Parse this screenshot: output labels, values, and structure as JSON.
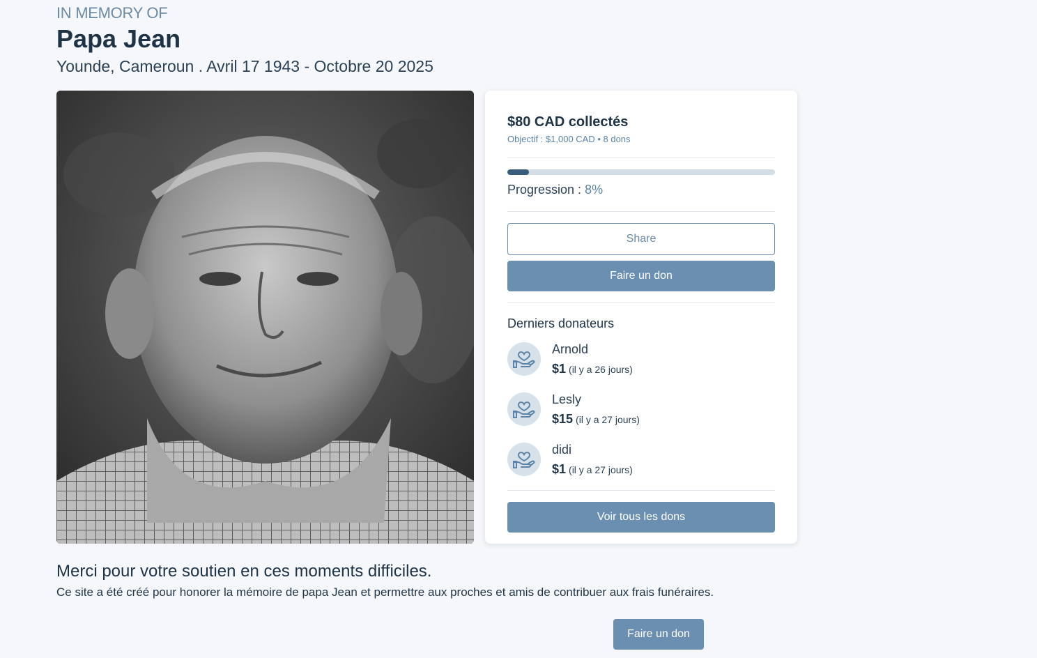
{
  "header": {
    "memory_label": "IN MEMORY OF",
    "name": "Papa Jean",
    "subtitle": "Younde, Cameroun . Avril 17 1943 - Octobre 20 2025"
  },
  "photo": {
    "description_icon": "portrait-photo"
  },
  "fundraiser": {
    "raised": "$80 CAD collectés",
    "goal_line": "Objectif : $1,000 CAD • 8 dons",
    "progress_label": "Progression : ",
    "progress_pct": "8%",
    "progress_value": 0.08,
    "share_label": "Share",
    "donate_label": "Faire un don"
  },
  "donors": {
    "title": "Derniers donateurs",
    "items": [
      {
        "name": "Arnold",
        "amount": "$1",
        "time": "(il y a 26 jours)"
      },
      {
        "name": "Lesly",
        "amount": "$15",
        "time": "(il y a 27 jours)"
      },
      {
        "name": "didi",
        "amount": "$1",
        "time": "(il y a 27 jours)"
      }
    ],
    "see_all_label": "Voir tous les dons",
    "avatar_icon": "hand-heart-icon"
  },
  "message": {
    "thanks": "Merci pour votre soutien en ces moments difficiles.",
    "description": "Ce site a été créé pour honorer la mémoire de papa Jean et permettre aux proches et amis de contribuer aux frais funéraires.",
    "donate_label": "Faire un don"
  },
  "colors": {
    "accent": "#6b8fb0",
    "progress_fill": "#3b5d7c",
    "text_dark": "#1f3347",
    "muted": "#6b8aa6"
  }
}
